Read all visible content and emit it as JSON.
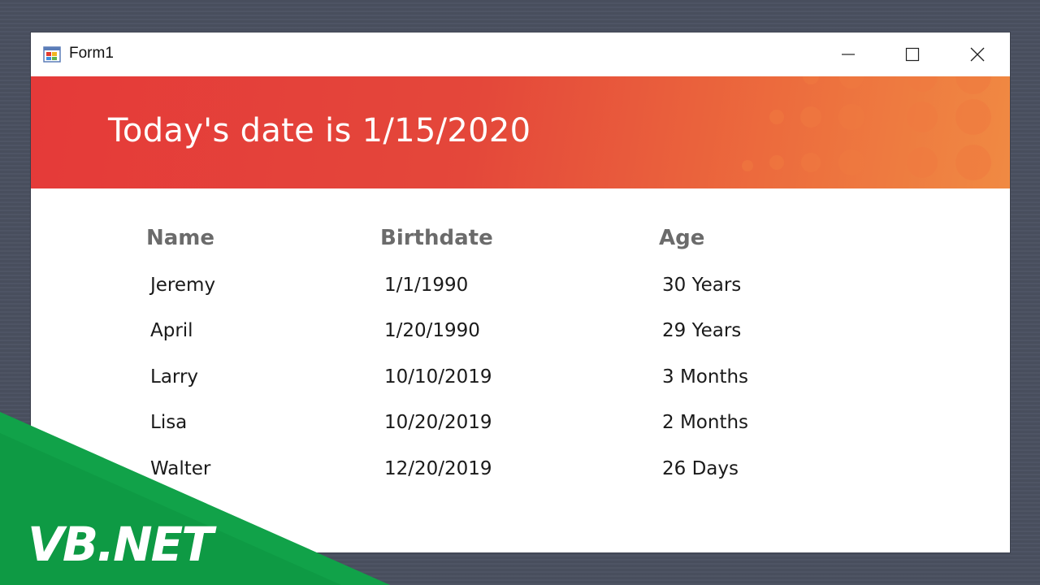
{
  "window": {
    "title": "Form1",
    "app_icon": "winforms-app-icon",
    "controls": {
      "minimize_icon": "minimize-icon",
      "maximize_icon": "maximize-icon",
      "close_icon": "close-icon"
    }
  },
  "banner": {
    "text": "Today's date is 1/15/2020",
    "colors": {
      "start": "#e53a39",
      "end": "#f08a43"
    }
  },
  "table": {
    "headers": {
      "name": "Name",
      "birthdate": "Birthdate",
      "age": "Age"
    },
    "rows": [
      {
        "name": "Jeremy",
        "birthdate": "1/1/1990",
        "age": "30 Years"
      },
      {
        "name": "April",
        "birthdate": "1/20/1990",
        "age": "29 Years"
      },
      {
        "name": "Larry",
        "birthdate": "10/10/2019",
        "age": "3 Months"
      },
      {
        "name": "Lisa",
        "birthdate": "10/20/2019",
        "age": "2 Months"
      },
      {
        "name": "Walter",
        "birthdate": "12/20/2019",
        "age": "26 Days"
      }
    ]
  },
  "overlay": {
    "label": "VB.NET",
    "color": "#0e9a44"
  }
}
